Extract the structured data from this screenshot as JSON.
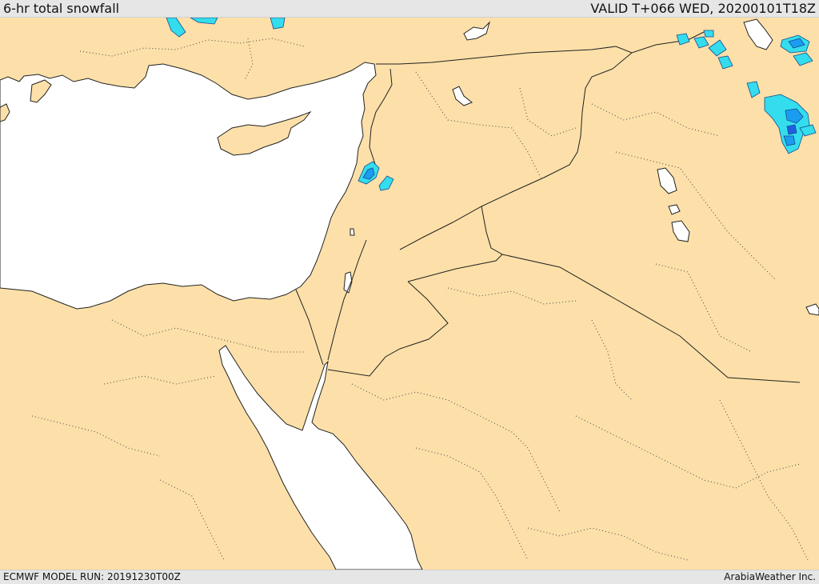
{
  "header": {
    "title": "6-hr total snowfall",
    "valid": "VALID T+066 WED, 20200101T18Z"
  },
  "footer": {
    "model_run": "ECMWF MODEL RUN: 20191230T00Z",
    "credit": "ArabiaWeather Inc."
  },
  "colors": {
    "land": "#fde0a9",
    "water": "#ffffff",
    "snow_light": "#33ddee",
    "snow_medium": "#1a9cf0",
    "snow_heavy": "#1e5fe0",
    "border": "#222222"
  }
}
